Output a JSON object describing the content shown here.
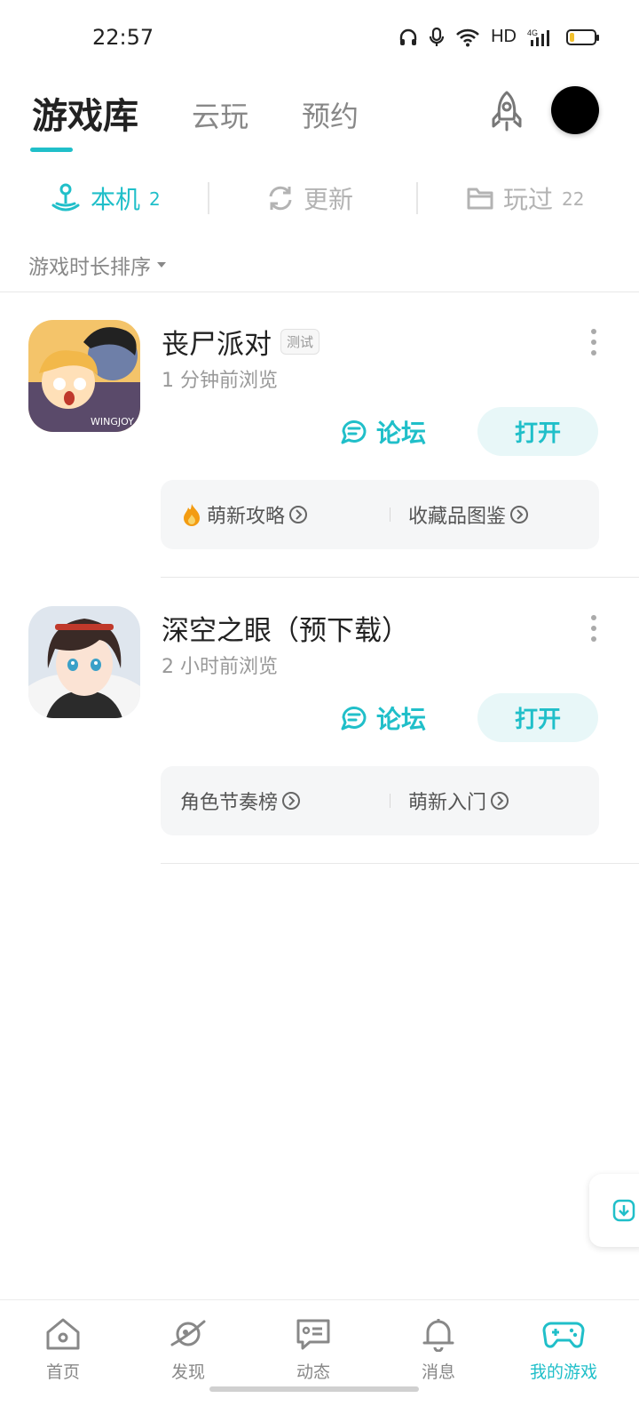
{
  "status_bar": {
    "time": "22:57",
    "network": "HD",
    "network_gen": "4G",
    "battery_level": 0.2
  },
  "header": {
    "tabs": [
      {
        "label": "游戏库",
        "active": true
      },
      {
        "label": "云玩",
        "active": false
      },
      {
        "label": "预约",
        "active": false
      }
    ]
  },
  "sub_tabs": [
    {
      "label": "本机",
      "count": "2",
      "icon": "joystick-icon",
      "active": true
    },
    {
      "label": "更新",
      "count": "",
      "icon": "refresh-icon",
      "active": false
    },
    {
      "label": "玩过",
      "count": "22",
      "icon": "folder-icon",
      "active": false
    }
  ],
  "sort": {
    "label": "游戏时长排序"
  },
  "games": [
    {
      "name": "丧尸派对",
      "tag": "测试",
      "last_viewed": "1 分钟前浏览",
      "forum_label": "论坛",
      "open_label": "打开",
      "links": [
        {
          "label": "萌新攻略",
          "prefix_icon": "fire-icon"
        },
        {
          "label": "收藏品图鉴",
          "prefix_icon": ""
        }
      ]
    },
    {
      "name": "深空之眼（预下载）",
      "tag": "",
      "last_viewed": "2 小时前浏览",
      "forum_label": "论坛",
      "open_label": "打开",
      "links": [
        {
          "label": "角色节奏榜",
          "prefix_icon": ""
        },
        {
          "label": "萌新入门",
          "prefix_icon": ""
        }
      ]
    }
  ],
  "bottom_nav": [
    {
      "label": "首页",
      "icon": "home-icon",
      "active": false
    },
    {
      "label": "发现",
      "icon": "planet-icon",
      "active": false
    },
    {
      "label": "动态",
      "icon": "chat-icon",
      "active": false
    },
    {
      "label": "消息",
      "icon": "bell-icon",
      "active": false
    },
    {
      "label": "我的游戏",
      "icon": "gamepad-icon",
      "active": true
    }
  ],
  "colors": {
    "accent": "#20bfc9",
    "text": "#222222",
    "muted": "#999999"
  }
}
